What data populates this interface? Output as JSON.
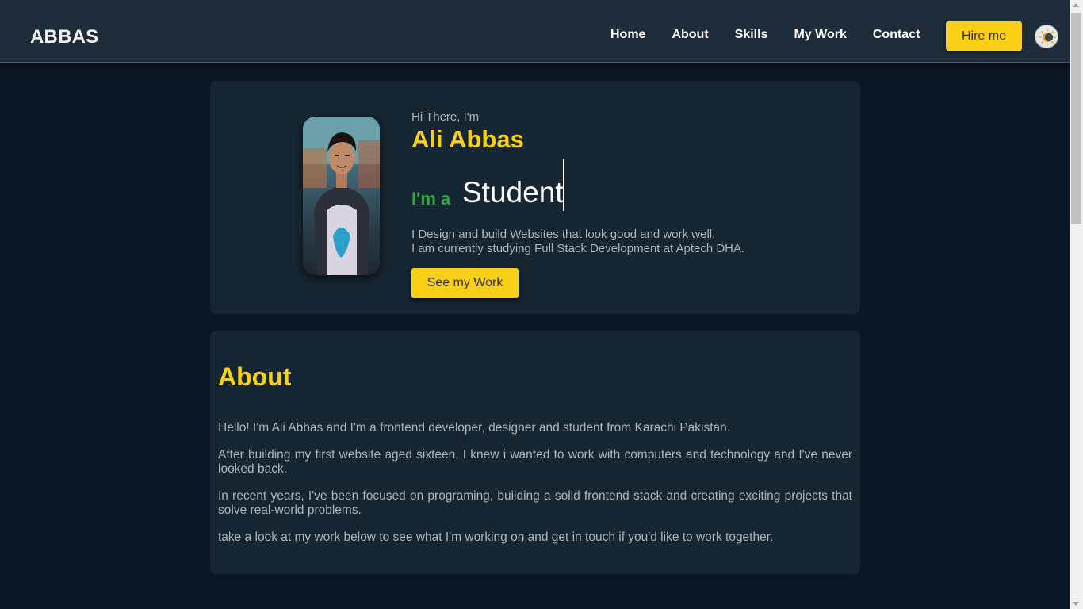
{
  "header": {
    "brand": "ABBAS",
    "nav": [
      "Home",
      "About",
      "Skills",
      "My Work",
      "Contact"
    ],
    "hire_label": "Hire me",
    "theme_icon": "theme-toggle-icon"
  },
  "hero": {
    "greeting": "Hi There, I'm",
    "name": "Ali Abbas",
    "role_prefix": "I'm a",
    "role": "Student",
    "tagline_line1": "I Design and build Websites that look good and work well.",
    "tagline_line2": "I am currently studying Full Stack Development at Aptech DHA.",
    "cta_label": "See my Work"
  },
  "about": {
    "title": "About",
    "paragraphs": [
      "Hello! I'm Ali Abbas and I'm a frontend developer, designer and student from Karachi Pakistan.",
      "After building my first website aged sixteen, I knew i wanted to work with computers and technology and I've never looked back.",
      "In recent years, I've been focused on programing, building a solid frontend stack and creating exciting projects that solve real-world problems.",
      "take a look at my work below to see what I'm working on and get in touch if you'd like to work together."
    ]
  },
  "colors": {
    "accent": "#f9d016",
    "role_green": "#2eaa3e",
    "background": "#0b1725",
    "card": "#162633",
    "navbar": "#1f2d3a"
  }
}
